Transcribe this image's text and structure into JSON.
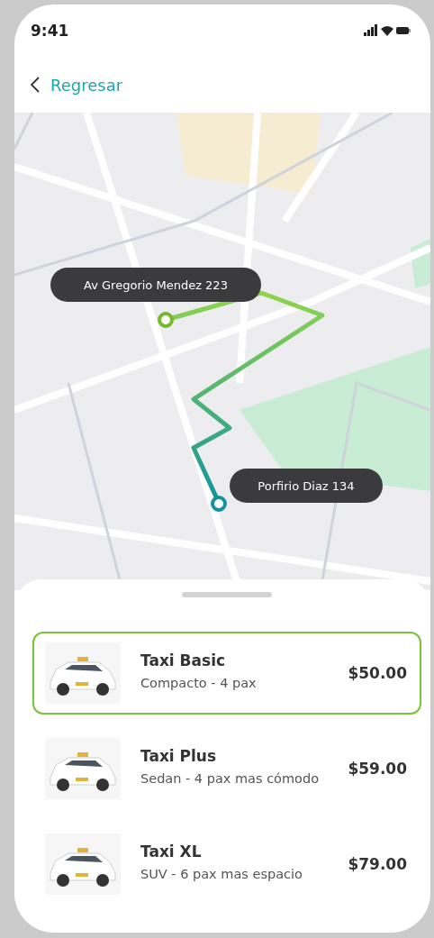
{
  "status_bar": {
    "time": "9:41"
  },
  "header": {
    "back_label": "Regresar"
  },
  "map": {
    "kind": "picture",
    "route_labels": [
      {
        "text": "Av Gregorio Mendez 223",
        "kind": "origin"
      },
      {
        "text": "Porfirio Diaz 134",
        "kind": "destination"
      }
    ]
  },
  "options": [
    {
      "name": "Taxi Basic",
      "description": "Compacto - 4 pax",
      "price": "$50.00",
      "selected": true
    },
    {
      "name": "Taxi Plus",
      "description": "Sedan - 4 pax mas cómodo",
      "price": "$59.00",
      "selected": false
    },
    {
      "name": "Taxi XL",
      "description": "SUV - 6 pax mas espacio",
      "price": "$79.00",
      "selected": false
    }
  ]
}
